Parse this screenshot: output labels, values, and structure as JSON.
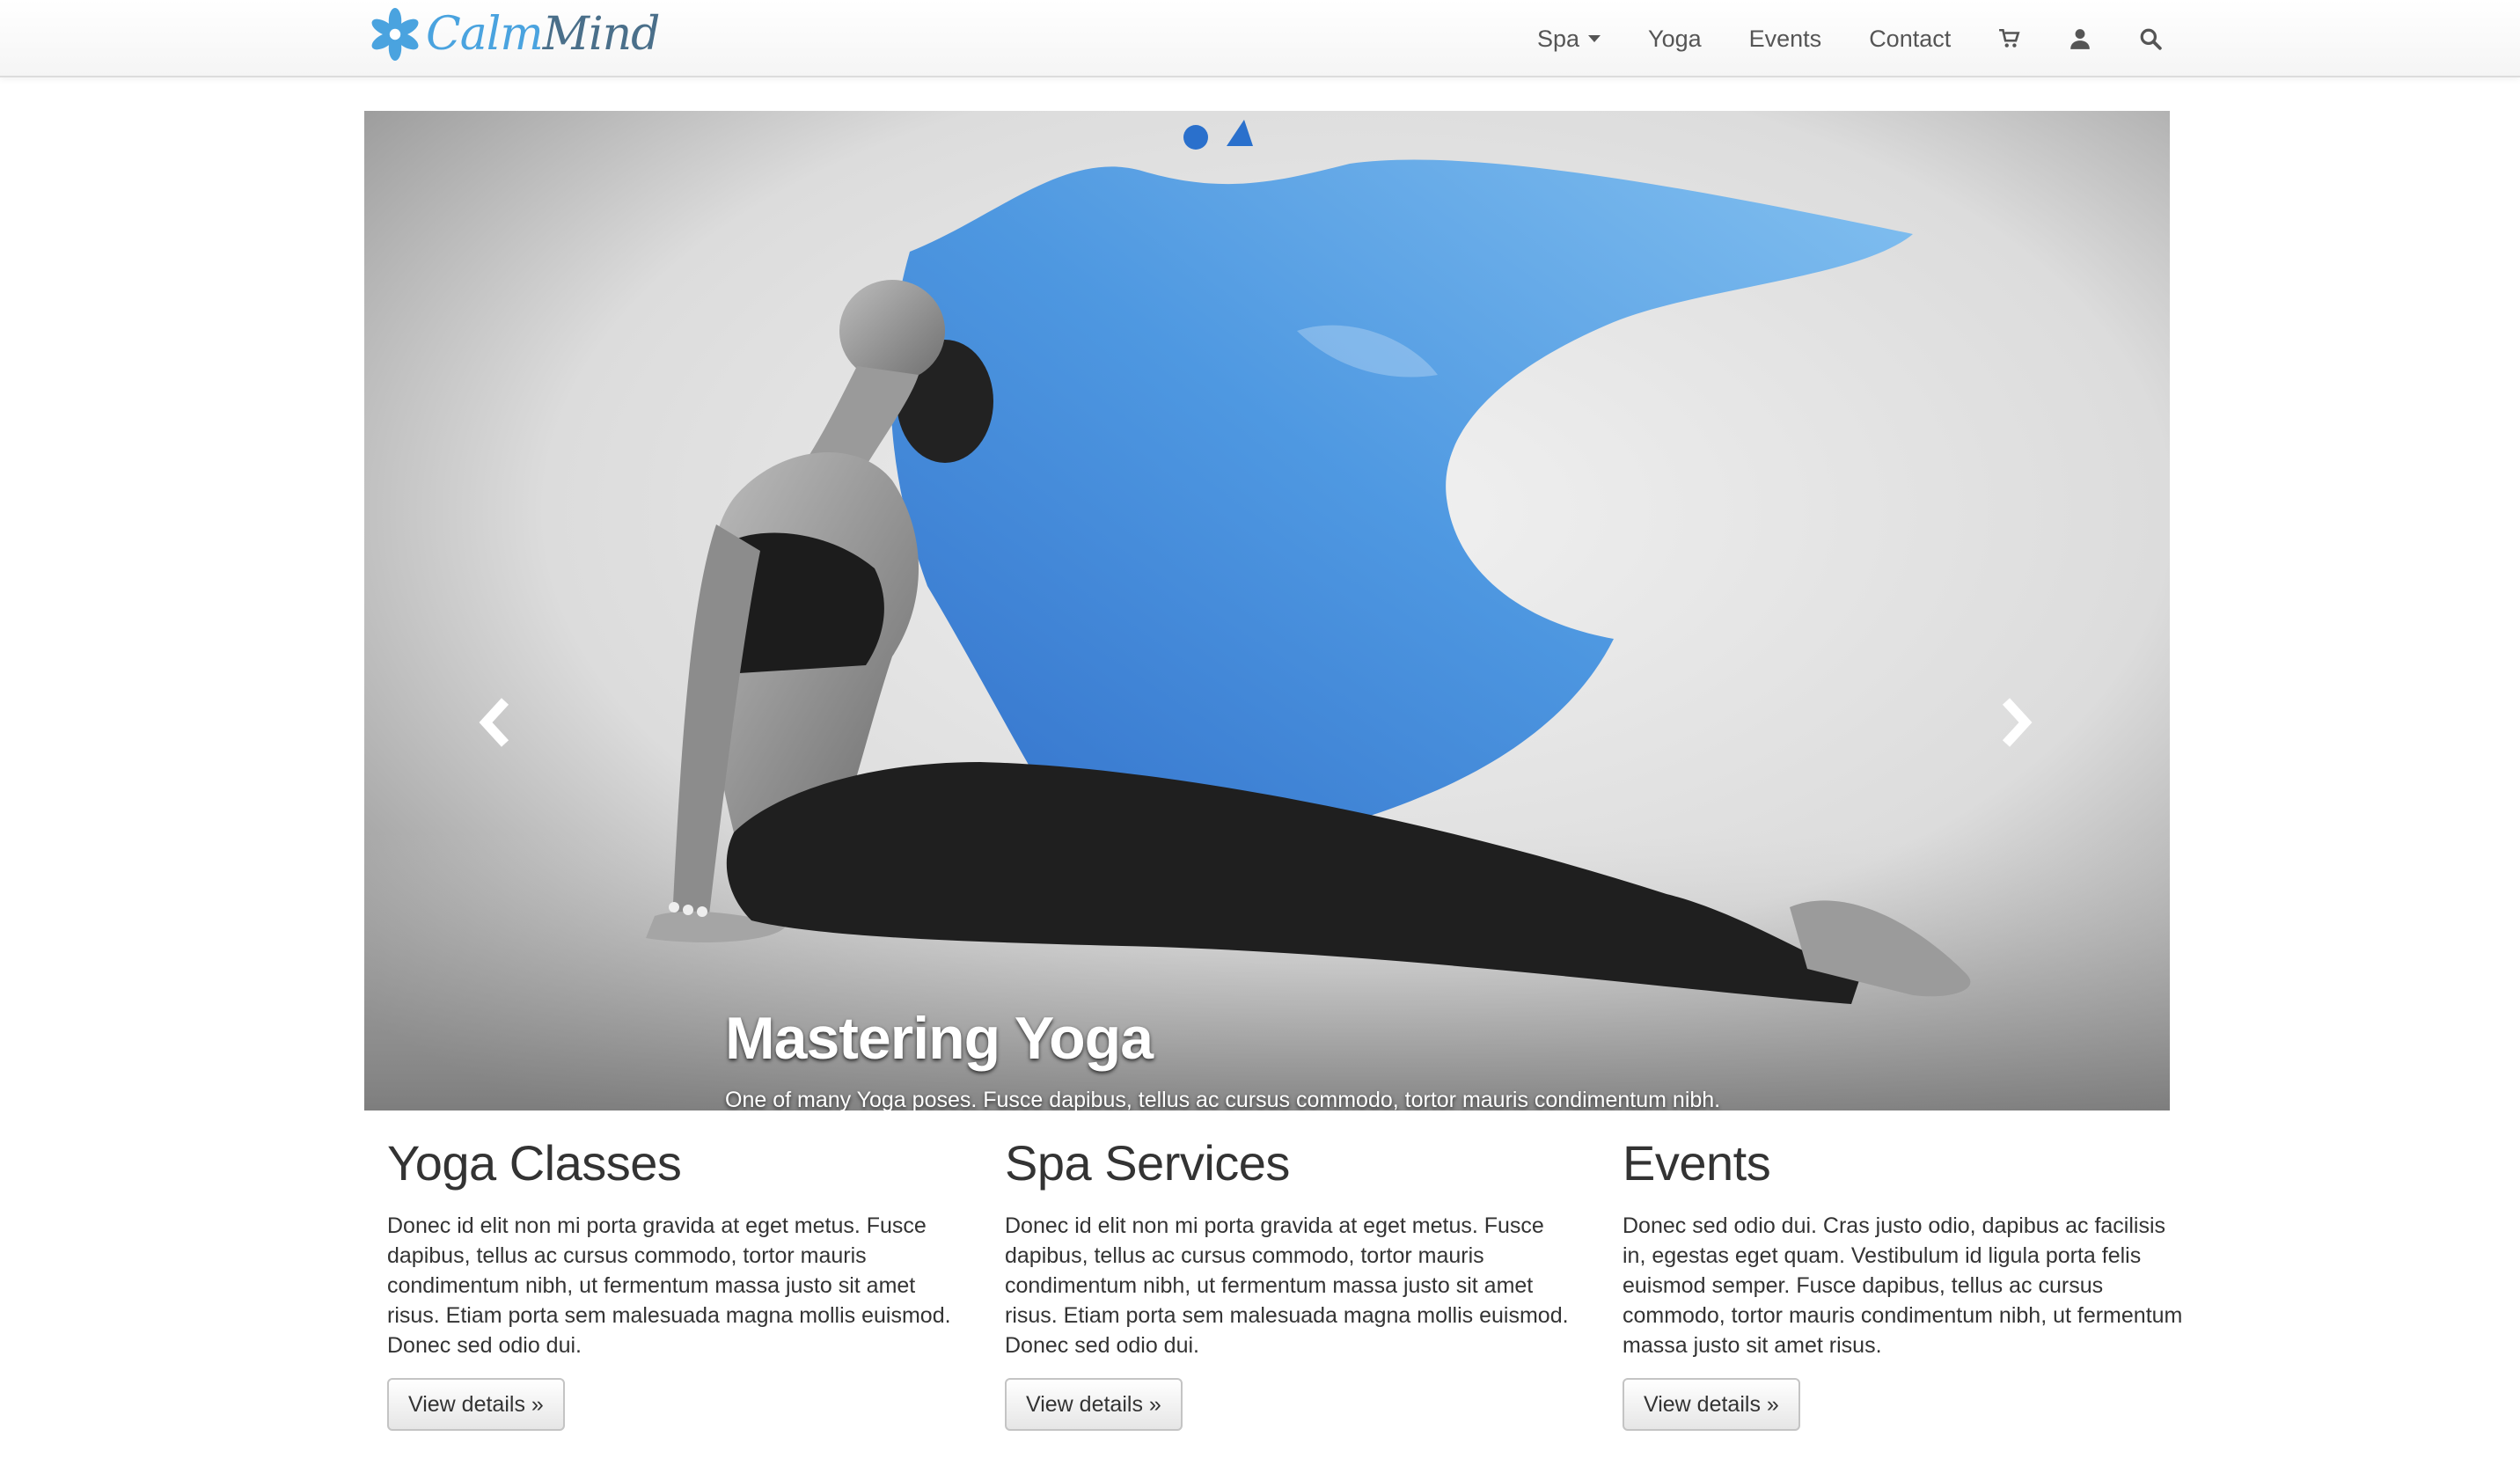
{
  "brand": {
    "name_part1": "Calm",
    "name_part2": "Mind",
    "logo_icon": "lotus-flower-icon",
    "color": "#4aa3df"
  },
  "nav": {
    "items": [
      {
        "label": "Spa",
        "has_dropdown": true
      },
      {
        "label": "Yoga"
      },
      {
        "label": "Events"
      },
      {
        "label": "Contact"
      }
    ],
    "icons": [
      "cart-icon",
      "user-icon",
      "search-icon"
    ]
  },
  "carousel": {
    "caption_title": "Mastering Yoga",
    "caption_text": "One of many Yoga poses. Fusce dapibus, tellus ac cursus commodo, tortor mauris condimentum nibh.",
    "slide_count": 4,
    "active_index": 0,
    "controls": [
      "chevron-left-icon",
      "chevron-right-icon"
    ]
  },
  "features": [
    {
      "title": "Yoga Classes",
      "text": "Donec id elit non mi porta gravida at eget metus. Fusce dapibus, tellus ac cursus commodo, tortor mauris condimentum nibh, ut fermentum massa justo sit amet risus. Etiam porta sem malesuada magna mollis euismod. Donec sed odio dui.",
      "button": "View details »"
    },
    {
      "title": "Spa Services",
      "text": "Donec id elit non mi porta gravida at eget metus. Fusce dapibus, tellus ac cursus commodo, tortor mauris condimentum nibh, ut fermentum massa justo sit amet risus. Etiam porta sem malesuada magna mollis euismod. Donec sed odio dui.",
      "button": "View details »"
    },
    {
      "title": "Events",
      "text": "Donec sed odio dui. Cras justo odio, dapibus ac facilisis in, egestas eget quam. Vestibulum id ligula porta felis euismod semper. Fusce dapibus, tellus ac cursus commodo, tortor mauris condimentum nibh, ut fermentum massa justo sit amet risus.",
      "button": "View details »"
    }
  ]
}
